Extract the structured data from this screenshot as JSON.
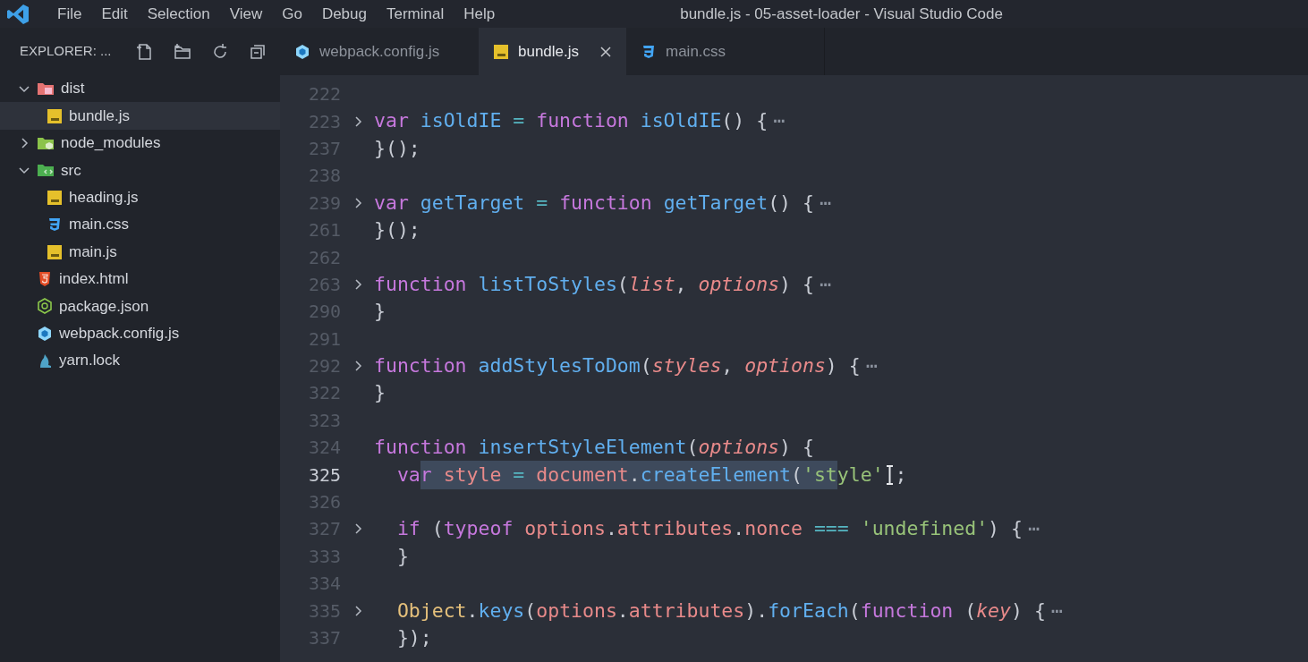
{
  "menu": [
    "File",
    "Edit",
    "Selection",
    "View",
    "Go",
    "Debug",
    "Terminal",
    "Help"
  ],
  "window": {
    "title": "bundle.js - 05-asset-loader - Visual Studio Code"
  },
  "explorer": {
    "title": "EXPLORER: ...",
    "tree": [
      {
        "name": "dist",
        "kind": "folder-dist",
        "expanded": true,
        "selected": false,
        "children": [
          {
            "name": "bundle.js",
            "kind": "js",
            "selected": true
          }
        ]
      },
      {
        "name": "node_modules",
        "kind": "folder-node",
        "expanded": false,
        "selected": false
      },
      {
        "name": "src",
        "kind": "folder-src",
        "expanded": true,
        "selected": false,
        "children": [
          {
            "name": "heading.js",
            "kind": "js",
            "selected": false
          },
          {
            "name": "main.css",
            "kind": "css",
            "selected": false
          },
          {
            "name": "main.js",
            "kind": "js",
            "selected": false
          }
        ]
      },
      {
        "name": "index.html",
        "kind": "html",
        "selected": false
      },
      {
        "name": "package.json",
        "kind": "node",
        "selected": false
      },
      {
        "name": "webpack.config.js",
        "kind": "webpack",
        "selected": false
      },
      {
        "name": "yarn.lock",
        "kind": "yarn",
        "selected": false
      }
    ]
  },
  "tabs": [
    {
      "label": "webpack.config.js",
      "kind": "webpack",
      "selected": false
    },
    {
      "label": "bundle.js",
      "kind": "js",
      "selected": true
    },
    {
      "label": "main.css",
      "kind": "css",
      "selected": false
    }
  ],
  "editor": {
    "lines": [
      {
        "n": "222",
        "folded": false,
        "current": false
      },
      {
        "n": "223",
        "folded": true,
        "current": false,
        "tokens": [
          {
            "text": "var ",
            "kind": "kw"
          },
          {
            "text": "isOldIE ",
            "kind": "fn"
          },
          {
            "text": "= ",
            "kind": "op"
          },
          {
            "text": "function ",
            "kind": "kw"
          },
          {
            "text": "isOldIE",
            "kind": "fn"
          },
          {
            "text": "() {",
            "kind": "plain"
          },
          {
            "text": "⋯",
            "kind": "fold"
          }
        ]
      },
      {
        "n": "237",
        "folded": false,
        "current": false,
        "tokens": [
          {
            "text": "}();",
            "kind": "plain"
          }
        ]
      },
      {
        "n": "238",
        "folded": false,
        "current": false
      },
      {
        "n": "239",
        "folded": true,
        "current": false,
        "tokens": [
          {
            "text": "var ",
            "kind": "kw"
          },
          {
            "text": "getTarget ",
            "kind": "fn"
          },
          {
            "text": "= ",
            "kind": "op"
          },
          {
            "text": "function ",
            "kind": "kw"
          },
          {
            "text": "getTarget",
            "kind": "fn"
          },
          {
            "text": "() {",
            "kind": "plain"
          },
          {
            "text": "⋯",
            "kind": "fold"
          }
        ]
      },
      {
        "n": "261",
        "folded": false,
        "current": false,
        "tokens": [
          {
            "text": "}();",
            "kind": "plain"
          }
        ]
      },
      {
        "n": "262",
        "folded": false,
        "current": false
      },
      {
        "n": "263",
        "folded": true,
        "current": false,
        "tokens": [
          {
            "text": "function ",
            "kind": "kw"
          },
          {
            "text": "listToStyles",
            "kind": "fn"
          },
          {
            "text": "(",
            "kind": "plain"
          },
          {
            "text": "list",
            "kind": "param"
          },
          {
            "text": ", ",
            "kind": "plain"
          },
          {
            "text": "options",
            "kind": "param"
          },
          {
            "text": ") {",
            "kind": "plain"
          },
          {
            "text": "⋯",
            "kind": "fold"
          }
        ]
      },
      {
        "n": "290",
        "folded": false,
        "current": false,
        "tokens": [
          {
            "text": "}",
            "kind": "plain"
          }
        ]
      },
      {
        "n": "291",
        "folded": false,
        "current": false
      },
      {
        "n": "292",
        "folded": true,
        "current": false,
        "tokens": [
          {
            "text": "function ",
            "kind": "kw"
          },
          {
            "text": "addStylesToDom",
            "kind": "fn"
          },
          {
            "text": "(",
            "kind": "plain"
          },
          {
            "text": "styles",
            "kind": "param"
          },
          {
            "text": ", ",
            "kind": "plain"
          },
          {
            "text": "options",
            "kind": "param"
          },
          {
            "text": ") {",
            "kind": "plain"
          },
          {
            "text": "⋯",
            "kind": "fold"
          }
        ]
      },
      {
        "n": "322",
        "folded": false,
        "current": false,
        "tokens": [
          {
            "text": "}",
            "kind": "plain"
          }
        ]
      },
      {
        "n": "323",
        "folded": false,
        "current": false
      },
      {
        "n": "324",
        "folded": false,
        "current": false,
        "tokens": [
          {
            "text": "function ",
            "kind": "kw"
          },
          {
            "text": "insertStyleElement",
            "kind": "fn"
          },
          {
            "text": "(",
            "kind": "plain"
          },
          {
            "text": "options",
            "kind": "param"
          },
          {
            "text": ") {",
            "kind": "plain"
          }
        ]
      },
      {
        "n": "325",
        "folded": false,
        "current": true,
        "segments": [
          {
            "highlighted": false,
            "tokens": [
              {
                "text": "  va",
                "kind": "kw"
              }
            ]
          },
          {
            "highlighted": true,
            "tokens": [
              {
                "text": "r ",
                "kind": "kw"
              },
              {
                "text": "style ",
                "kind": "prop"
              },
              {
                "text": "= ",
                "kind": "op"
              },
              {
                "text": "document",
                "kind": "prop"
              },
              {
                "text": ".",
                "kind": "plain"
              },
              {
                "text": "createElement",
                "kind": "fn"
              },
              {
                "text": "(",
                "kind": "plain"
              },
              {
                "text": "'st",
                "kind": "str"
              }
            ]
          },
          {
            "highlighted": false,
            "tokens": [
              {
                "text": "yle'",
                "kind": "str"
              }
            ]
          },
          {
            "kind": "mouse"
          },
          {
            "highlighted": false,
            "tokens": [
              {
                "text": ";",
                "kind": "plain"
              }
            ]
          }
        ]
      },
      {
        "n": "326",
        "folded": false,
        "current": false
      },
      {
        "n": "327",
        "folded": true,
        "current": false,
        "tokens": [
          {
            "text": "  if",
            "kind": "kw"
          },
          {
            "text": " (",
            "kind": "plain"
          },
          {
            "text": "typeof ",
            "kind": "kw"
          },
          {
            "text": "options",
            "kind": "prop"
          },
          {
            "text": ".",
            "kind": "plain"
          },
          {
            "text": "attributes",
            "kind": "prop"
          },
          {
            "text": ".",
            "kind": "plain"
          },
          {
            "text": "nonce ",
            "kind": "prop"
          },
          {
            "text": "=== ",
            "kind": "op"
          },
          {
            "text": "'undefined'",
            "kind": "str"
          },
          {
            "text": ") {",
            "kind": "plain"
          },
          {
            "text": "⋯",
            "kind": "fold"
          }
        ]
      },
      {
        "n": "333",
        "folded": false,
        "current": false,
        "tokens": [
          {
            "text": "  }",
            "kind": "plain"
          }
        ]
      },
      {
        "n": "334",
        "folded": false,
        "current": false
      },
      {
        "n": "335",
        "folded": true,
        "current": false,
        "tokens": [
          {
            "text": "  Object",
            "kind": "cls"
          },
          {
            "text": ".",
            "kind": "plain"
          },
          {
            "text": "keys",
            "kind": "fn"
          },
          {
            "text": "(",
            "kind": "plain"
          },
          {
            "text": "options",
            "kind": "prop"
          },
          {
            "text": ".",
            "kind": "plain"
          },
          {
            "text": "attributes",
            "kind": "prop"
          },
          {
            "text": ").",
            "kind": "plain"
          },
          {
            "text": "forEach",
            "kind": "fn"
          },
          {
            "text": "(",
            "kind": "plain"
          },
          {
            "text": "function",
            "kind": "kw"
          },
          {
            "text": " (",
            "kind": "plain"
          },
          {
            "text": "key",
            "kind": "param"
          },
          {
            "text": ") {",
            "kind": "plain"
          },
          {
            "text": "⋯",
            "kind": "fold"
          }
        ]
      },
      {
        "n": "337",
        "folded": false,
        "current": false,
        "tokens": [
          {
            "text": "  });",
            "kind": "plain"
          }
        ]
      }
    ]
  }
}
